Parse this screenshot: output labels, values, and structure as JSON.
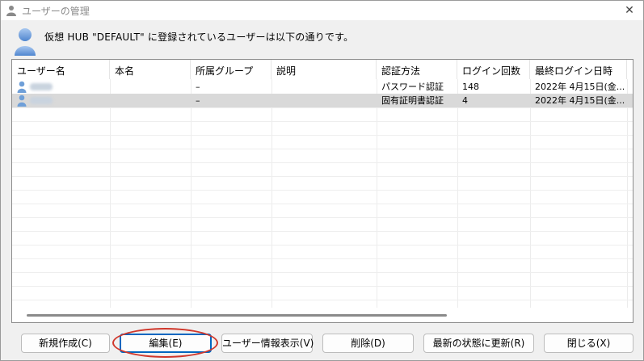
{
  "window": {
    "title": "ユーザーの管理",
    "close_glyph": "✕"
  },
  "header": {
    "message": "仮想 HUB \"DEFAULT\" に登録されているユーザーは以下の通りです。"
  },
  "table": {
    "columns": [
      "ユーザー名",
      "本名",
      "所属グループ",
      "説明",
      "認証方法",
      "ログイン回数",
      "最終ログイン日時"
    ],
    "rows": [
      {
        "username": "",
        "realname": "",
        "group": "–",
        "description": "",
        "auth": "パスワード認証",
        "logins": "148",
        "last_login": "2022年 4月15日(金...",
        "selected": false
      },
      {
        "username": "",
        "realname": "",
        "group": "–",
        "description": "",
        "auth": "固有証明書認証",
        "logins": "4",
        "last_login": "2022年 4月15日(金...",
        "selected": true
      }
    ]
  },
  "buttons": {
    "new": "新規作成(C)",
    "edit": "編集(E)",
    "info": "ユーザー情報表示(V)",
    "delete": "削除(D)",
    "refresh": "最新の状態に更新(R)",
    "close": "閉じる(X)"
  },
  "colors": {
    "selection": "#d9d9d9",
    "annotation": "#d0372b",
    "focus": "#0067c0",
    "user_icon": "#6f9fd8"
  },
  "icons": {
    "title": "user-icon",
    "header": "user-icon",
    "row": "user-icon",
    "close": "close-icon"
  }
}
